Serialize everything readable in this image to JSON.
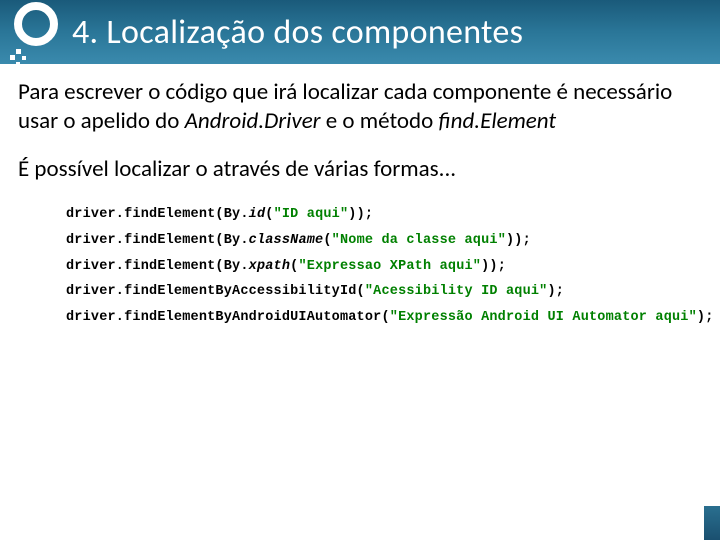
{
  "header": {
    "title": "4. Localização dos componentes"
  },
  "body": {
    "p1_a": "Para escrever o código que irá localizar cada componente é necessário usar o apelido do ",
    "p1_b": "Android.Driver",
    "p1_c": " e o método ",
    "p1_d": "find.Element",
    "p2": "É possível localizar o através de várias formas..."
  },
  "code": {
    "lines": [
      {
        "prefix": "driver.findElement(By.",
        "method": "id",
        "open": "(",
        "str": "\"ID aqui\"",
        "close": "));",
        "methodItalic": true
      },
      {
        "prefix": "driver.findElement(By.",
        "method": "className",
        "open": "(",
        "str": "\"Nome da classe aqui\"",
        "close": "));",
        "methodItalic": true
      },
      {
        "prefix": "driver.findElement(By.",
        "method": "xpath",
        "open": "(",
        "str": "\"Expressao XPath aqui\"",
        "close": "));",
        "methodItalic": true
      },
      {
        "prefix": "driver.",
        "method": "findElementByAccessibilityId",
        "open": "(",
        "str": "\"Acessibility ID aqui\"",
        "close": ");",
        "methodItalic": false
      },
      {
        "prefix": "driver.",
        "method": "findElementByAndroidUIAutomator",
        "open": "(",
        "str": "\"Expressão Android UI Automator aqui\"",
        "close": ");",
        "methodItalic": false
      }
    ]
  }
}
